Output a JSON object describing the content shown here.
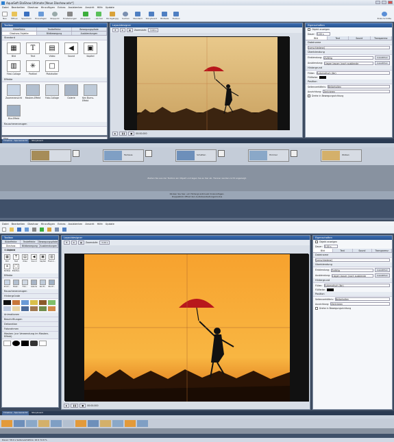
{
  "s1": {
    "title": "AquaSoft DiaShow Ultimate [Neue Diashow.adx*]",
    "menu": [
      "Datei",
      "Bearbeiten",
      "Diashow",
      "Hinzufügen",
      "Extras",
      "Assistenten",
      "Ansicht",
      "Hilfe",
      "Update"
    ],
    "tools": [
      "Neu",
      "Öffnen",
      "Speichern",
      "Hinzufügen",
      "Stoppuhr",
      "Einstellungen",
      "Abspielen",
      "...ab hier",
      "Rückgängig",
      "Suchen",
      "Standard",
      "Storyboard",
      "Bildteile",
      "Toolbox"
    ],
    "tools_right": "Erste Schritte",
    "toolbox_title": "Toolbox",
    "toolbox_tabs": [
      "Bildeffekte",
      "Textteffekte",
      "Bewegungspfade"
    ],
    "toolbox_tabs2": [
      "Diashow-Objekte",
      "Bildbewegung",
      "Ausblendungen"
    ],
    "section_standard": "Standard",
    "items": [
      "Bild",
      "Text",
      "Video",
      "Sound",
      "Kapitel",
      "Flexi-Collage"
    ],
    "items2": [
      "Partikel",
      "Platzhalter"
    ],
    "section_effekte": "Effekte",
    "effects": [
      "Zoomeransicht",
      "Masken-Effekt",
      "Foto-Collage",
      "Galerie",
      "Ken Burns-Effekt",
      "Blur-Effekt"
    ],
    "section_rauschen": "Rauschenerzeugen",
    "filter_label": "Filter",
    "preview_title": "Layoutdesigner",
    "zoom_label": "Zoomstufe:",
    "zoom_value": "3.00 s",
    "time_display": "00:00.000",
    "props_title": "Eigenschaften",
    "props_check": "Objekt anzeigen",
    "props_dauer_label": "Dauer:",
    "props_dauer": "5.00 s",
    "props_tabs": [
      "Bild",
      "Text",
      "Sound",
      "Transparenz"
    ],
    "props_dateiname": "Dateiname",
    "props_file": "[verschiedene]",
    "props_ueber": "Überblendung",
    "props_ein_label": "Einblendung:",
    "props_ein": "Zufällig",
    "props_aus_label": "Ausblendung:",
    "props_aus": "Liegen lassen (noch ausblende",
    "props_btn": "Auswählen",
    "props_hintergrund": "Hintergrund",
    "props_fuellen_label": "Füllen:",
    "props_fuellen": "Automatisch (tbr)",
    "props_farbe_label": "Füllfarbe:",
    "props_position": "Position",
    "props_sv_label": "Seitenverhältnis:",
    "props_sv": "Beibehalten",
    "props_ausr_label": "Ausrichtung:",
    "props_ausr": "Zentrieren",
    "props_drehe": "Drehe in Bewegungsrichtung",
    "timeline_tabs": [
      "Timeline - Spursansicht",
      "Storyboard"
    ],
    "timeline_hint": "Ziehen Sie aus der Toolbox ein Objekt und legen Sie es hier ab. Trenner werden nicht angezeigt.",
    "timeline_hint2": "Klicken Sie hier, um Hintergrundmusik hinzuzufügen.",
    "timeline_hint3": "Doppelklick öffnet den Audiobearbeitungsmodus",
    "clips": [
      "Fantasie",
      "Schatten",
      "Himmel",
      "Wolken",
      "Regen"
    ]
  },
  "s2": {
    "menu": [
      "Datei",
      "Bearbeiten",
      "Diashow",
      "Hinzufügen",
      "Extras",
      "Assistenten",
      "Ansicht",
      "Hilfe",
      "Update"
    ],
    "toolbox_title": "Toolbox",
    "toolbox_tabs": [
      "Bildeffekte",
      "Texteffekte",
      "Bewegungspfade"
    ],
    "toolbox_tabs2": [
      "Diashow-Objekte",
      "Bildbewegung",
      "Ausblendungen"
    ],
    "section_standard": "Standard",
    "items": [
      "Bild",
      "Text",
      "Video",
      "Sound",
      "Kapitel",
      "Flexi-C...",
      "Partikel",
      "Platzhal.."
    ],
    "section_effekte": "Effekte",
    "effects": [
      "Zoom...",
      "Mask...",
      "Foto...",
      "Galerie",
      "Ken B...",
      "Blur-E..."
    ],
    "section_rauschen": "Rauschenerzeugen",
    "section_hintergrund": "Hintergründe",
    "section_animationen": "Animationen",
    "section_beschriftungen": "Beschriftungen",
    "section_dekoration": "Dekoration",
    "section_fotoruegeln": "Fotorahmen",
    "section_masken": "Masken (zur Verwendung im Masken-Effekt)",
    "preview_title": "Layoutdesigner",
    "zoom_label": "Zoomstufe:",
    "zoom_value": "3.00 s",
    "time_display": "00:00.000",
    "props_title": "Eigenschaften",
    "props_check": "Objekt anzeigen",
    "props_dauer_label": "Dauer:",
    "props_dauer": "5.00 s",
    "props_tabs": [
      "Bild",
      "Text",
      "Sound",
      "Transparenz"
    ],
    "props_dateiname": "Dateiname",
    "props_file": "[verschiedene]",
    "props_ueber": "Überblendung",
    "props_ein_label": "Einblendung:",
    "props_ein": "Zufällig",
    "props_aus_label": "Ausblendung:",
    "props_aus": "Liegen lassen (noch ausblende",
    "props_btn": "Auswählen",
    "props_hintergrund": "Hintergrund",
    "props_fuellen_label": "Füllen:",
    "props_fuellen": "Automatisch (tbr)",
    "props_farbe_label": "Füllfarbe:",
    "props_position": "Position",
    "props_sv_label": "Seitenverhältnis:",
    "props_sv": "Beibehalten",
    "props_ausr_label": "Ausrichtung:",
    "props_ausr": "Zentrieren",
    "props_drehe": "Drehe in Bewegungsrichtung",
    "timeline_tabs": [
      "Timeline - Spursansicht",
      "Storyboard"
    ],
    "status": "Dauer: 58.0 s   Seitenverhältnis: 16:9   72.8 %"
  },
  "colors": {
    "sky_top": "#f8b642",
    "sky_bottom": "#d96a10",
    "umbrella": "#b8171c",
    "panel_head": "#2f5f9f"
  }
}
